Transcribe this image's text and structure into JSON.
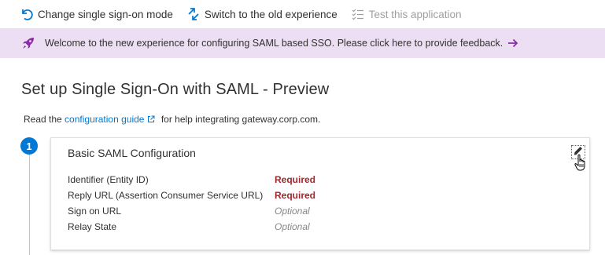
{
  "toolbar": {
    "change_mode_label": "Change single sign-on mode",
    "switch_old_label": "Switch to the old experience",
    "test_app_label": "Test this application"
  },
  "banner": {
    "message": "Welcome to the new experience for configuring SAML based SSO. Please click here to provide feedback."
  },
  "page": {
    "title": "Set up Single Sign-On with SAML - Preview",
    "intro_prefix": "Read the",
    "intro_link": "configuration guide",
    "intro_suffix": "for help integrating gateway.corp.com."
  },
  "step": {
    "number": "1",
    "card_title": "Basic SAML Configuration",
    "fields": [
      {
        "label": "Identifier (Entity ID)",
        "status": "Required"
      },
      {
        "label": "Reply URL (Assertion Consumer Service URL)",
        "status": "Required"
      },
      {
        "label": "Sign on URL",
        "status": "Optional"
      },
      {
        "label": "Relay State",
        "status": "Optional"
      }
    ]
  },
  "colors": {
    "accent": "#0078d4",
    "banner_bg": "#ecdff3",
    "banner_icon": "#8a2da5",
    "required": "#a4262c",
    "optional": "#8a8886"
  }
}
